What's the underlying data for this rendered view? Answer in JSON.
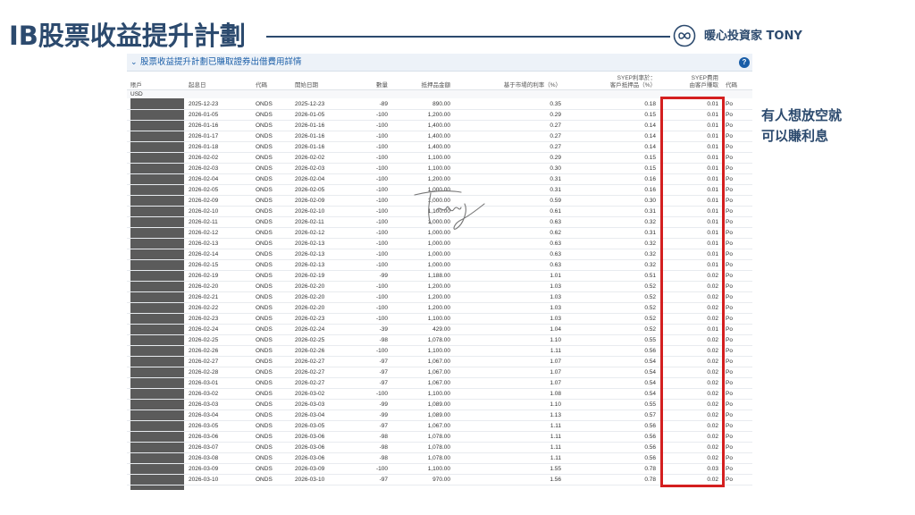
{
  "title": "IB股票收益提升計劃",
  "brand": "暖心投資家 TONY",
  "panel": {
    "chevron": "⌄",
    "title": "股票收益提升計劃已賺取證券出借費用詳情",
    "help": "?"
  },
  "columns": [
    {
      "label": "賬戶"
    },
    {
      "label": "起息日"
    },
    {
      "label": "代碼"
    },
    {
      "label": "開始日期"
    },
    {
      "label": "數量"
    },
    {
      "label": "抵押品金額"
    },
    {
      "label": "基于市場的利率（%）"
    },
    {
      "label": "SYEP利率於：\n客戶抵押品（%）"
    },
    {
      "label": "SYEP費用\n由客戶賺取"
    },
    {
      "label": "代碼"
    }
  ],
  "group_label": "USD",
  "rows": [
    [
      "2025-12-23",
      "ONDS",
      "2025-12-23",
      "-89",
      "890.00",
      "0.35",
      "0.18",
      "0.01",
      "Po"
    ],
    [
      "2026-01-05",
      "ONDS",
      "2026-01-05",
      "-100",
      "1,200.00",
      "0.29",
      "0.15",
      "0.01",
      "Po"
    ],
    [
      "2026-01-16",
      "ONDS",
      "2026-01-16",
      "-100",
      "1,400.00",
      "0.27",
      "0.14",
      "0.01",
      "Po"
    ],
    [
      "2026-01-17",
      "ONDS",
      "2026-01-16",
      "-100",
      "1,400.00",
      "0.27",
      "0.14",
      "0.01",
      "Po"
    ],
    [
      "2026-01-18",
      "ONDS",
      "2026-01-16",
      "-100",
      "1,400.00",
      "0.27",
      "0.14",
      "0.01",
      "Po"
    ],
    [
      "2026-02-02",
      "ONDS",
      "2026-02-02",
      "-100",
      "1,100.00",
      "0.29",
      "0.15",
      "0.01",
      "Po"
    ],
    [
      "2026-02-03",
      "ONDS",
      "2026-02-03",
      "-100",
      "1,100.00",
      "0.30",
      "0.15",
      "0.01",
      "Po"
    ],
    [
      "2026-02-04",
      "ONDS",
      "2026-02-04",
      "-100",
      "1,200.00",
      "0.31",
      "0.16",
      "0.01",
      "Po"
    ],
    [
      "2026-02-05",
      "ONDS",
      "2026-02-05",
      "-100",
      "1,000.00",
      "0.31",
      "0.16",
      "0.01",
      "Po"
    ],
    [
      "2026-02-09",
      "ONDS",
      "2026-02-09",
      "-100",
      "1,000.00",
      "0.59",
      "0.30",
      "0.01",
      "Po"
    ],
    [
      "2026-02-10",
      "ONDS",
      "2026-02-10",
      "-100",
      "1,100.00",
      "0.61",
      "0.31",
      "0.01",
      "Po"
    ],
    [
      "2026-02-11",
      "ONDS",
      "2026-02-11",
      "-100",
      "1,000.00",
      "0.63",
      "0.32",
      "0.01",
      "Po"
    ],
    [
      "2026-02-12",
      "ONDS",
      "2026-02-12",
      "-100",
      "1,000.00",
      "0.62",
      "0.31",
      "0.01",
      "Po"
    ],
    [
      "2026-02-13",
      "ONDS",
      "2026-02-13",
      "-100",
      "1,000.00",
      "0.63",
      "0.32",
      "0.01",
      "Po"
    ],
    [
      "2026-02-14",
      "ONDS",
      "2026-02-13",
      "-100",
      "1,000.00",
      "0.63",
      "0.32",
      "0.01",
      "Po"
    ],
    [
      "2026-02-15",
      "ONDS",
      "2026-02-13",
      "-100",
      "1,000.00",
      "0.63",
      "0.32",
      "0.01",
      "Po"
    ],
    [
      "2026-02-19",
      "ONDS",
      "2026-02-19",
      "-99",
      "1,188.00",
      "1.01",
      "0.51",
      "0.02",
      "Po"
    ],
    [
      "2026-02-20",
      "ONDS",
      "2026-02-20",
      "-100",
      "1,200.00",
      "1.03",
      "0.52",
      "0.02",
      "Po"
    ],
    [
      "2026-02-21",
      "ONDS",
      "2026-02-20",
      "-100",
      "1,200.00",
      "1.03",
      "0.52",
      "0.02",
      "Po"
    ],
    [
      "2026-02-22",
      "ONDS",
      "2026-02-20",
      "-100",
      "1,200.00",
      "1.03",
      "0.52",
      "0.02",
      "Po"
    ],
    [
      "2026-02-23",
      "ONDS",
      "2026-02-23",
      "-100",
      "1,100.00",
      "1.03",
      "0.52",
      "0.02",
      "Po"
    ],
    [
      "2026-02-24",
      "ONDS",
      "2026-02-24",
      "-39",
      "429.00",
      "1.04",
      "0.52",
      "0.01",
      "Po"
    ],
    [
      "2026-02-25",
      "ONDS",
      "2026-02-25",
      "-98",
      "1,078.00",
      "1.10",
      "0.55",
      "0.02",
      "Po"
    ],
    [
      "2026-02-26",
      "ONDS",
      "2026-02-26",
      "-100",
      "1,100.00",
      "1.11",
      "0.56",
      "0.02",
      "Po"
    ],
    [
      "2026-02-27",
      "ONDS",
      "2026-02-27",
      "-97",
      "1,067.00",
      "1.07",
      "0.54",
      "0.02",
      "Po"
    ],
    [
      "2026-02-28",
      "ONDS",
      "2026-02-27",
      "-97",
      "1,067.00",
      "1.07",
      "0.54",
      "0.02",
      "Po"
    ],
    [
      "2026-03-01",
      "ONDS",
      "2026-02-27",
      "-97",
      "1,067.00",
      "1.07",
      "0.54",
      "0.02",
      "Po"
    ],
    [
      "2026-03-02",
      "ONDS",
      "2026-03-02",
      "-100",
      "1,100.00",
      "1.08",
      "0.54",
      "0.02",
      "Po"
    ],
    [
      "2026-03-03",
      "ONDS",
      "2026-03-03",
      "-99",
      "1,089.00",
      "1.10",
      "0.55",
      "0.02",
      "Po"
    ],
    [
      "2026-03-04",
      "ONDS",
      "2026-03-04",
      "-99",
      "1,089.00",
      "1.13",
      "0.57",
      "0.02",
      "Po"
    ],
    [
      "2026-03-05",
      "ONDS",
      "2026-03-05",
      "-97",
      "1,067.00",
      "1.11",
      "0.56",
      "0.02",
      "Po"
    ],
    [
      "2026-03-06",
      "ONDS",
      "2026-03-06",
      "-98",
      "1,078.00",
      "1.11",
      "0.56",
      "0.02",
      "Po"
    ],
    [
      "2026-03-07",
      "ONDS",
      "2026-03-06",
      "-98",
      "1,078.00",
      "1.11",
      "0.56",
      "0.02",
      "Po"
    ],
    [
      "2026-03-08",
      "ONDS",
      "2026-03-06",
      "-98",
      "1,078.00",
      "1.11",
      "0.56",
      "0.02",
      "Po"
    ],
    [
      "2026-03-09",
      "ONDS",
      "2026-03-09",
      "-100",
      "1,100.00",
      "1.55",
      "0.78",
      "0.03",
      "Po"
    ],
    [
      "2026-03-10",
      "ONDS",
      "2026-03-10",
      "-97",
      "970.00",
      "1.56",
      "0.78",
      "0.02",
      "Po"
    ]
  ],
  "annotation": {
    "line1": "有人想放空就",
    "line2": "可以賺利息"
  },
  "colors": {
    "title": "#2c4a6e",
    "panel_link": "#1a5ea8",
    "highlight": "#d41f1f",
    "account_redaction": "#5b5b5b"
  },
  "icons": {
    "logo": "infinity-heart-logo-icon",
    "help": "help-circle-icon",
    "chevron": "chevron-down-icon",
    "signature": "handwritten-signature-icon"
  }
}
